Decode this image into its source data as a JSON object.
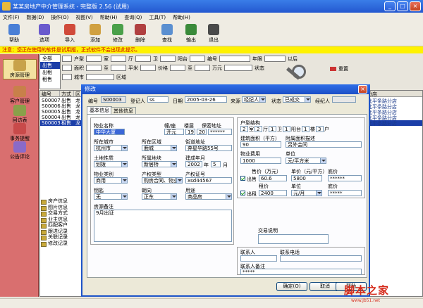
{
  "window": {
    "title": "某某房地产中介管理系统 - 完整版 2.56 (试用)"
  },
  "menu": [
    "文件(F)",
    "数据(D)",
    "操作(O)",
    "视图(V)",
    "帮助(H)",
    "查询(Q)",
    "工具(T)",
    "帮助(H)"
  ],
  "toolbar": [
    {
      "label": "帮助",
      "icon": "help-icon",
      "color": "#4a7fd6"
    },
    {
      "label": "选项",
      "icon": "options-icon",
      "color": "#6a5acd"
    },
    {
      "label": "导入",
      "icon": "import-icon",
      "color": "#d04a3a"
    },
    {
      "label": "添加",
      "icon": "add-icon",
      "color": "#d0a040"
    },
    {
      "label": "修改",
      "icon": "edit-icon",
      "color": "#4aa04a"
    },
    {
      "label": "删除",
      "icon": "delete-icon",
      "color": "#b04040"
    },
    {
      "label": "查找",
      "icon": "find-icon",
      "color": "#5a8fd0"
    },
    {
      "label": "输出",
      "icon": "output-icon",
      "color": "#3a8a3a"
    },
    {
      "label": "退出",
      "icon": "exit-icon",
      "color": "#4a4a4a"
    }
  ],
  "notice": "注意：您正在使用的软件是试用版，正式软件不会出现此提示。",
  "sidebar": [
    {
      "label": "房源管理",
      "icon": "house-icon",
      "active": true
    },
    {
      "label": "客户管理",
      "icon": "client-icon"
    },
    {
      "label": "回访表",
      "icon": "visit-icon"
    },
    {
      "label": "事务提醒",
      "icon": "reminder-icon"
    },
    {
      "label": "公告评论",
      "icon": "notice-icon"
    }
  ],
  "typeList": [
    "全部",
    "出售",
    "出租",
    "租售"
  ],
  "filters": {
    "row1": [
      "户型",
      "室",
      "厅",
      "卫",
      "阳台",
      "编号",
      "年限",
      "以后"
    ],
    "row2": [
      "面积",
      "至",
      "平米",
      "价格",
      "至",
      "万元",
      "状态"
    ],
    "row3": [
      "城市",
      "区域"
    ],
    "reset": "重置"
  },
  "grid": {
    "headers": [
      "编号",
      "方式",
      "区"
    ],
    "rows": [
      {
        "id": "S00007",
        "mode": "出售",
        "area": "龙"
      },
      {
        "id": "S00006",
        "mode": "出售",
        "area": "龙"
      },
      {
        "id": "S00005",
        "mode": "出售",
        "area": "龙"
      },
      {
        "id": "S00004",
        "mode": "出售",
        "area": "龙"
      },
      {
        "id": "S00003",
        "mode": "租售",
        "area": "龙",
        "selected": true
      }
    ],
    "rightHeader": "分店",
    "rightCells": [
      "北平条路分店",
      "北平条路分店",
      "北平条路分店",
      "北平条路分店",
      "北平条路分店"
    ]
  },
  "subList": [
    "房产信息",
    "图片信息",
    "交易方式",
    "业主信息",
    "匹配客户",
    "跟进记录",
    "关联记录",
    "修改记录"
  ],
  "dialog": {
    "title": "修改",
    "top": {
      "bianhao_label": "编号",
      "bianhao": "S00003",
      "dengji_label": "登记人",
      "dengji": "ss",
      "riqi_label": "日期",
      "riqi": "2005-03-26",
      "laiyuan_label": "来源",
      "laiyuan": "经纪人",
      "zhuangtai_label": "状态",
      "zhuangtai": "已成交",
      "jingjiren_label": "经纪人",
      "jingjiren": ""
    },
    "tabs": [
      "基本信息",
      "其他信息"
    ],
    "fields": {
      "wuye_label": "物业名称",
      "wuye": "中华大厦",
      "dongzuo_label": "幢/座",
      "dongzuo": "开元",
      "louceng_label": "楼层",
      "louceng_a": "19",
      "louceng_b": "20",
      "louceng_c": "20",
      "baomi_label": "保密地址",
      "baomi": "******",
      "chengshi_label": "所在城市",
      "chengshi": "杭州市",
      "quyu_label": "所在区域",
      "quyu": "鹿城",
      "jiedao_label": "街道地址",
      "jiedao": "奔星华路55号",
      "tudi_label": "土地性质",
      "tudi": "划拨",
      "quanshu_label": "所属地块",
      "quanshu": "新居桥",
      "niandai_label": "建成年月",
      "niandai": "2002",
      "niandai_unit": "年",
      "niandai_m": "5",
      "niandai_unit2": "月",
      "leibie_label": "物业类别",
      "leibie": "商用",
      "chanquan_label": "产权类型",
      "chanquan": "购房合同、物业",
      "zhenghao_label": "产权证号",
      "zhenghao": "xsd44567",
      "yaoshi_label": "钥匙",
      "yaoshi": "无",
      "chaoxiang_label": "朝向",
      "chaoxiang": "正东",
      "yongtu_label": "用途",
      "yongtu": "商品房",
      "beizhu_label": "房源备注",
      "beizhu": "9月出证",
      "huxing_label": "户型结构",
      "hx": [
        "2",
        "室",
        "2",
        "厅",
        "1",
        "卫",
        "1",
        "阳台",
        "1",
        "楼",
        "3",
        "户"
      ],
      "mianji_label": "建筑面积（平方）",
      "mianji": "90",
      "fushu_label": "附属面积描述",
      "fushu": "另外会间",
      "wuyefei_label": "物业费用",
      "wuyefei": "1000",
      "danwei_label": "单位",
      "danwei": "元/平方米",
      "shoujia_label": "售价（万元）",
      "shoujia": "60.6",
      "shoujia_unit_label": "单价（元/平方）",
      "shoujia_unit": "5800",
      "dijia_label": "底价",
      "dijia": "******",
      "chushou_label": "出售",
      "chuzu_label": "出租",
      "zujin_label": "租价",
      "zujin": "2400",
      "zujin_dw_label": "单位",
      "zujin_dw": "元/月",
      "zujin_dj_label": "底价",
      "zujin_dj": "*****",
      "jiaoyi_label": "交易说明",
      "jiaoyi": "",
      "lianxiren_label": "联系人",
      "lianxiren": "",
      "dianhua_label": "联系电话",
      "dianhua": "",
      "lxbeizhu_label": "联系人备注",
      "lxbeizhu": "*****"
    },
    "ok": "确定(O)",
    "cancel": "取消",
    "help": "帮助"
  },
  "watermark": {
    "text": "脚本之家",
    "sub": "www.Jb51.net"
  }
}
